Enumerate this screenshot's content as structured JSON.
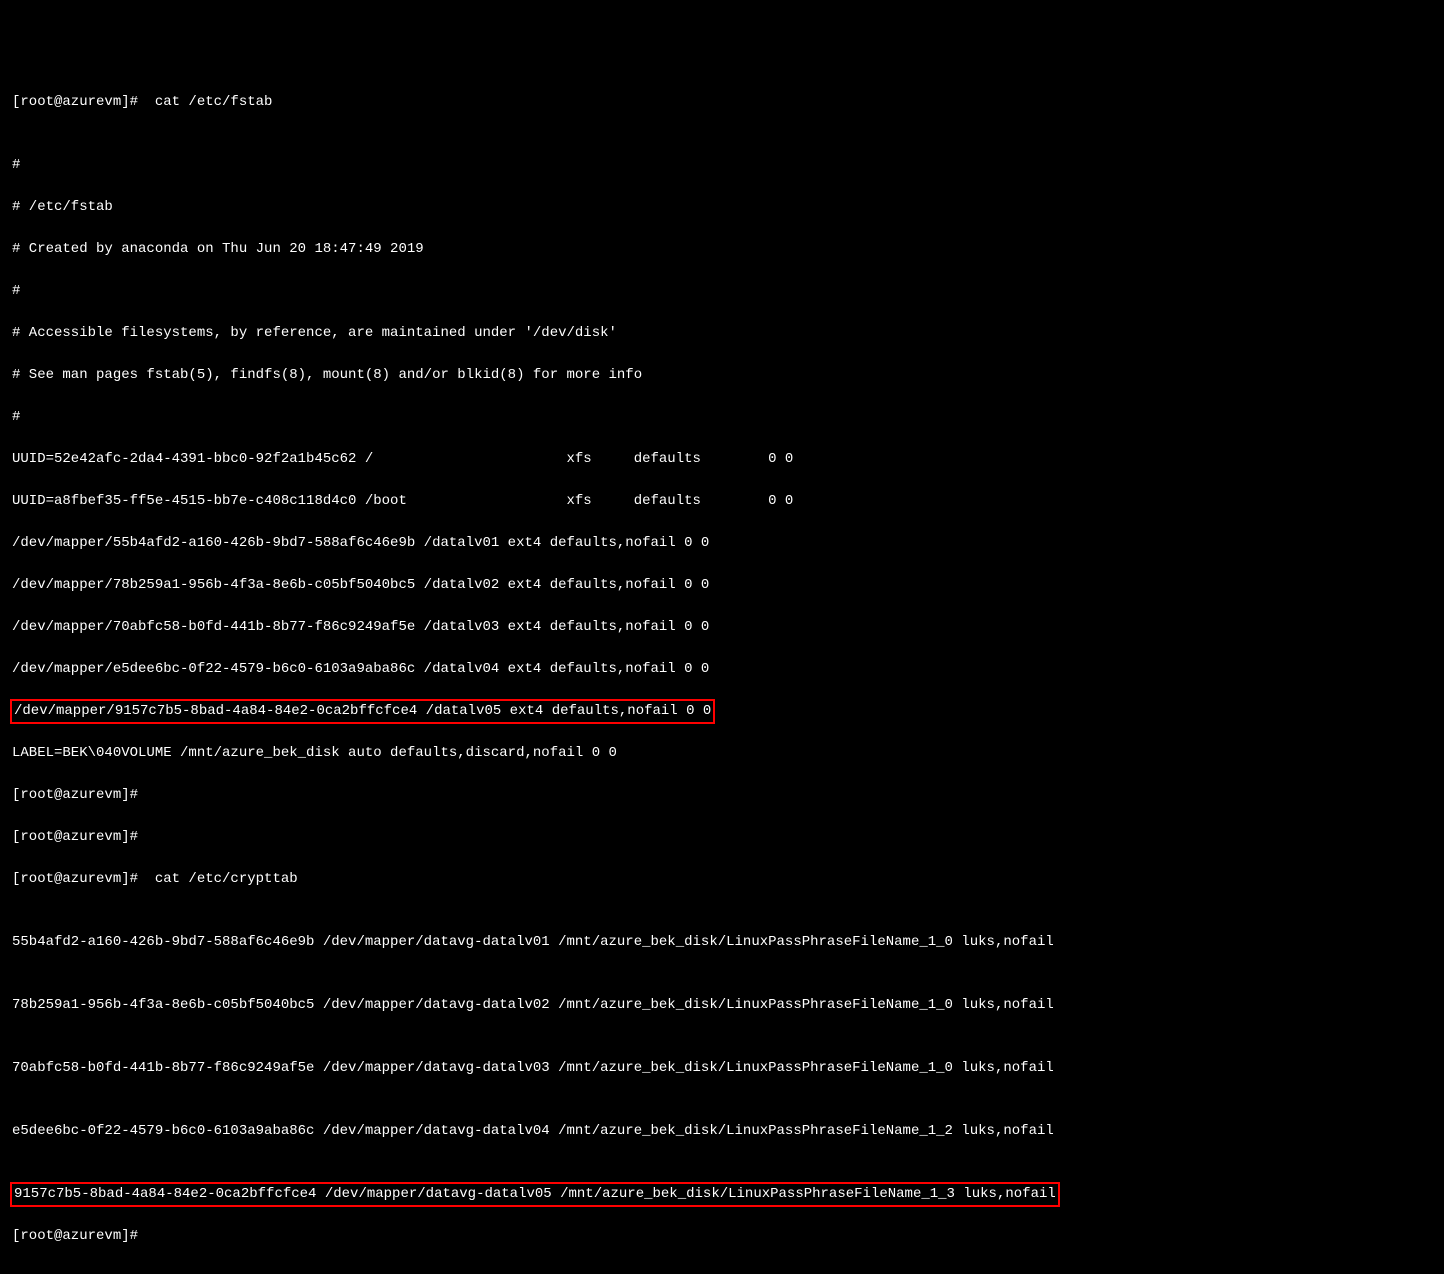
{
  "prompt1": "[root@azurevm]#  cat /etc/fstab",
  "blank1": "",
  "l1": "#",
  "l2": "# /etc/fstab",
  "l3": "# Created by anaconda on Thu Jun 20 18:47:49 2019",
  "l4": "#",
  "l5": "# Accessible filesystems, by reference, are maintained under '/dev/disk'",
  "l6": "# See man pages fstab(5), findfs(8), mount(8) and/or blkid(8) for more info",
  "l7": "#",
  "l8": "UUID=52e42afc-2da4-4391-bbc0-92f2a1b45c62 /                       xfs     defaults        0 0",
  "l9": "UUID=a8fbef35-ff5e-4515-bb7e-c408c118d4c0 /boot                   xfs     defaults        0 0",
  "l10": "/dev/mapper/55b4afd2-a160-426b-9bd7-588af6c46e9b /datalv01 ext4 defaults,nofail 0 0",
  "l11": "/dev/mapper/78b259a1-956b-4f3a-8e6b-c05bf5040bc5 /datalv02 ext4 defaults,nofail 0 0",
  "l12": "/dev/mapper/70abfc58-b0fd-441b-8b77-f86c9249af5e /datalv03 ext4 defaults,nofail 0 0",
  "l13": "/dev/mapper/e5dee6bc-0f22-4579-b6c0-6103a9aba86c /datalv04 ext4 defaults,nofail 0 0",
  "l14": "/dev/mapper/9157c7b5-8bad-4a84-84e2-0ca2bffcfce4 /datalv05 ext4 defaults,nofail 0 0",
  "l15": "LABEL=BEK\\040VOLUME /mnt/azure_bek_disk auto defaults,discard,nofail 0 0",
  "prompt2": "[root@azurevm]#",
  "prompt3": "[root@azurevm]#",
  "prompt4": "[root@azurevm]#  cat /etc/crypttab",
  "blank2": "",
  "c1": "55b4afd2-a160-426b-9bd7-588af6c46e9b /dev/mapper/datavg-datalv01 /mnt/azure_bek_disk/LinuxPassPhraseFileName_1_0 luks,nofail",
  "blank3": "",
  "c2": "78b259a1-956b-4f3a-8e6b-c05bf5040bc5 /dev/mapper/datavg-datalv02 /mnt/azure_bek_disk/LinuxPassPhraseFileName_1_0 luks,nofail",
  "blank4": "",
  "c3": "70abfc58-b0fd-441b-8b77-f86c9249af5e /dev/mapper/datavg-datalv03 /mnt/azure_bek_disk/LinuxPassPhraseFileName_1_0 luks,nofail",
  "blank5": "",
  "c4": "e5dee6bc-0f22-4579-b6c0-6103a9aba86c /dev/mapper/datavg-datalv04 /mnt/azure_bek_disk/LinuxPassPhraseFileName_1_2 luks,nofail",
  "blank6": "",
  "c5": "9157c7b5-8bad-4a84-84e2-0ca2bffcfce4 /dev/mapper/datavg-datalv05 /mnt/azure_bek_disk/LinuxPassPhraseFileName_1_3 luks,nofail",
  "prompt5": "[root@azurevm]#"
}
